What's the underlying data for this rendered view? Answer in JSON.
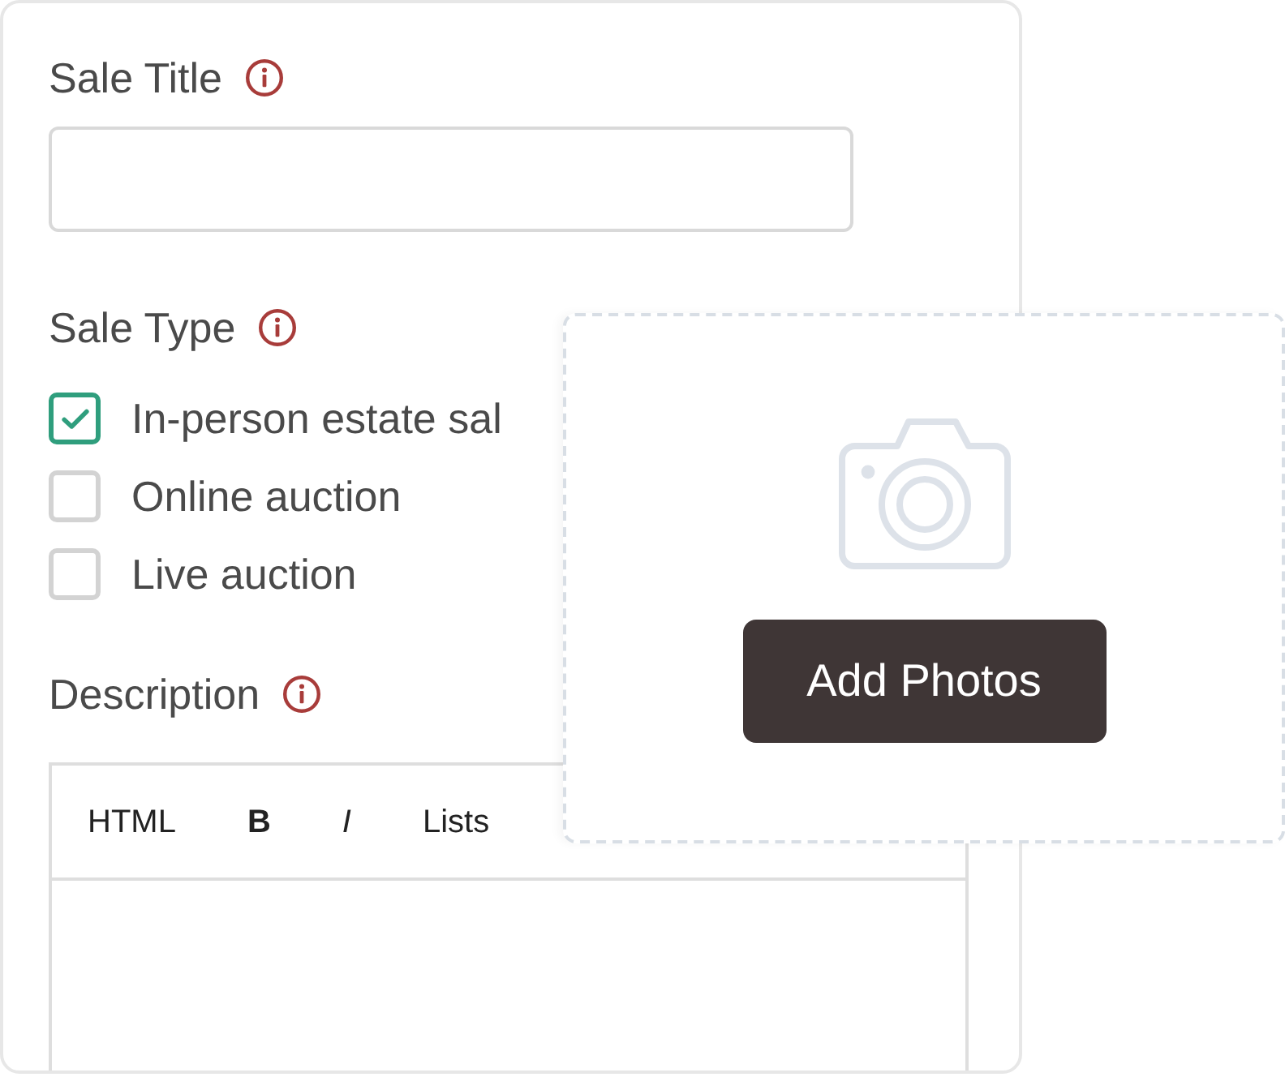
{
  "sale_title": {
    "label": "Sale Title"
  },
  "sale_type": {
    "label": "Sale Type",
    "options": [
      {
        "label": "In-person estate sal",
        "checked": true
      },
      {
        "label": "Online auction",
        "checked": false
      },
      {
        "label": "Live auction",
        "checked": false
      }
    ]
  },
  "description": {
    "label": "Description",
    "toolbar": [
      {
        "label": "HTML",
        "kind": "html"
      },
      {
        "label": "B",
        "kind": "bold"
      },
      {
        "label": "I",
        "kind": "italic"
      },
      {
        "label": "Lists",
        "kind": "lists"
      }
    ]
  },
  "photo_upload": {
    "button": "Add Photos"
  }
}
